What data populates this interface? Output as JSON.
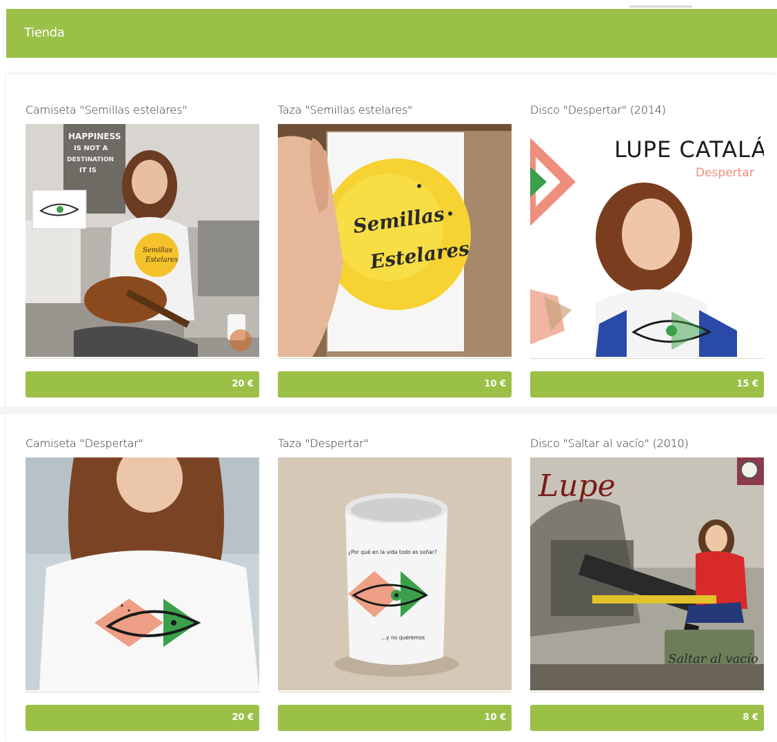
{
  "header": {
    "title": "Tienda"
  },
  "colors": {
    "accent": "#9bc048",
    "title_text": "#2b2b2b"
  },
  "products": [
    {
      "title": "Camiseta \"Semillas estelares\"",
      "price": "20 €",
      "image": "woman-guitar-tshirt-photo",
      "image_text": [
        "HAPPINESS",
        "IS NOT A",
        "DESTINATION",
        "IT IS",
        "Semillas",
        "Estelares"
      ]
    },
    {
      "title": "Taza \"Semillas estelares\"",
      "price": "10 €",
      "image": "mug-semillas-estelares-photo",
      "image_text": [
        "Semillas",
        "Estelares"
      ]
    },
    {
      "title": "Disco \"Despertar\" (2014)",
      "price": "15 €",
      "image": "album-cover-despertar",
      "image_text": [
        "LUPE CATALÁ",
        "Despertar"
      ]
    },
    {
      "title": "Camiseta \"Despertar\"",
      "price": "20 €",
      "image": "woman-despertar-tshirt-photo",
      "image_text": []
    },
    {
      "title": "Taza \"Despertar\"",
      "price": "10 €",
      "image": "mug-despertar-photo",
      "image_text": [
        "¿Por qué en la vida todo es soñar?",
        "...y no queremos"
      ]
    },
    {
      "title": "Disco \"Saltar al vacío\" (2010)",
      "price": "8 €",
      "image": "album-cover-saltar-al-vacio",
      "image_text": [
        "Lupe",
        "Saltar al vacío"
      ]
    }
  ]
}
